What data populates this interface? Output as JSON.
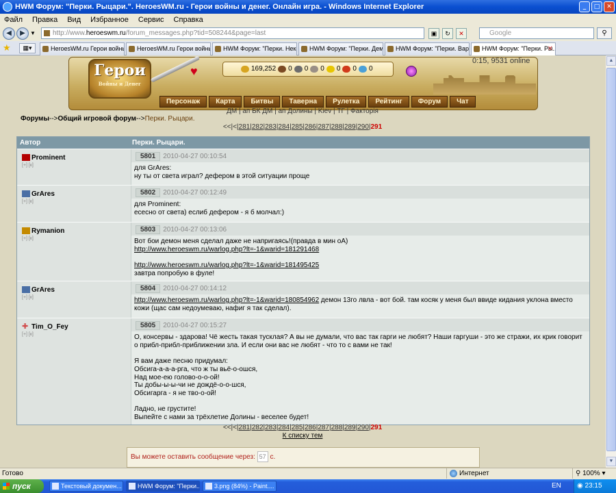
{
  "window": {
    "title": "HWM Форум: \"Перки. Рыцари.\". HeroesWM.ru - Герои войны и денег. Онлайн игра. - Windows Internet Explorer",
    "buttons": {
      "min": "_",
      "max": "□",
      "close": "✕"
    }
  },
  "menu": [
    "Файл",
    "Правка",
    "Вид",
    "Избранное",
    "Сервис",
    "Справка"
  ],
  "address": {
    "prefix": "http://www.",
    "host": "heroeswm.ru",
    "path": "/forum_messages.php?tid=508244&page=last"
  },
  "search": {
    "placeholder": "Google"
  },
  "tabs": [
    {
      "label": "HeroesWM.ru Герои войны ..."
    },
    {
      "label": "HeroesWM.ru Герои войны ..."
    },
    {
      "label": "HWM Форум: \"Перки. Некро..."
    },
    {
      "label": "HWM Форум: \"Перки. Демо..."
    },
    {
      "label": "HWM Форум: \"Перки. Варва..."
    },
    {
      "label": "HWM Форум: \"Перки. Ры..."
    }
  ],
  "game": {
    "logo_big": "Герои",
    "logo_small": "Войны и Денег",
    "resources": [
      "169,252",
      "0",
      "0",
      "0",
      "0",
      "0",
      "0"
    ],
    "resource_colors": [
      "#d7a521",
      "#7b4a23",
      "#6d6d6d",
      "#9a8f86",
      "#e8c600",
      "#d13a1b",
      "#4aa0d8"
    ],
    "online": "0:15, 9531 online",
    "nav": [
      "Персонаж",
      "Карта",
      "Битвы",
      "Таверна",
      "Рулетка",
      "Рейтинг",
      "Форум",
      "Чат"
    ],
    "sublinks": "ДМ | ап БК ДМ | ап Долины | Kiev | ТГ | Факторія"
  },
  "breadcrumb": {
    "forums": "Форумы",
    "sep1": "-->",
    "section": "Общий игровой форум",
    "sep2": "-->",
    "current": "Перки. Рыцари."
  },
  "pager": {
    "prefix": "<<|<|",
    "pages": [
      "281",
      "282",
      "283",
      "284",
      "285",
      "286",
      "287",
      "288",
      "289",
      "290"
    ],
    "current": "291"
  },
  "table": {
    "col_author": "Автор",
    "col_topic": "Перки. Рыцари."
  },
  "posts": [
    {
      "author": "Prominent",
      "icon_color": "#b30000",
      "small": "[+] [к]",
      "num": "5801",
      "date": "2010-04-27 00:10:54",
      "lines": [
        "для GrAres:",
        "ну ты от света играл? дефером в этой ситуации проще"
      ],
      "links": []
    },
    {
      "author": "GrAres",
      "icon_color": "#4a6fa5",
      "small": "[+] [к]",
      "num": "5802",
      "date": "2010-04-27 00:12:49",
      "lines": [
        "для Prominent:",
        "есесно от света) еслиб дефером - я б молчал:)"
      ],
      "links": []
    },
    {
      "author": "Rymanion",
      "icon_color": "#c48a00",
      "small": "[+] [к]",
      "num": "5803",
      "date": "2010-04-27 00:13:06",
      "lines": [
        "Вот бои демон меня сделал даже не напригаясь!(правда в мин оА)"
      ],
      "links": [
        "http://www.heroeswm.ru/warlog.php?lt=-1&warid=181291468",
        "http://www.heroeswm.ru/warlog.php?lt=-1&warid=181495425"
      ],
      "tail": "завтра попробую в фуле!"
    },
    {
      "author": "GrAres",
      "icon_color": "#4a6fa5",
      "small": "[+] [к]",
      "num": "5804",
      "date": "2010-04-27 00:14:12",
      "link_inline": "http://www.heroeswm.ru/warlog.php?lt=-1&warid=180854962",
      "after_link": " демон 13го лвла - вот бой. там косяк у меня был ввиде кидания уклона вместо кожи (щас сам недоумеваю, нафиг я так сделал)."
    },
    {
      "author": "Tim_O_Fey",
      "icon_color": "#d04a4a",
      "small": "[+] [к]",
      "num": "5805",
      "date": "2010-04-27 00:15:27",
      "text": "О, консервы - здарова! Чё жесть такая тусклая? А вы не думали, что вас так гарги не любят? Наши гаргуши - это же стражи, их крик говорит о прибл-прибл-приближении зла. И если они вас не любят - что то с вами не так!\n\nЯ вам даже песню придумал:\nОбсига-а-а-а-рга, что ж ты вьё-о-ошся,\nНад мое-ею голово-о-о-ой!\nТы добы-ы-ы-чи не дождё-о-о-шся,\nОбсигарга - я не тво-о-ой!\n\nЛадно, не грустите!\nВыпейте с нами за трёхлетие Долины - веселее будет!"
    }
  ],
  "back_to_list": "К списку тем",
  "reply": {
    "text": "Вы можете оставить сообщение через:",
    "count": "57",
    "unit": "с."
  },
  "status": {
    "text": "Готово",
    "zone": "Интернет",
    "zoom": "100%"
  },
  "taskbar": {
    "start": "пуск",
    "tasks": [
      "Текстовый докумен...",
      "HWM Форум: \"Перки...",
      "3.png (84%) - Paint...."
    ],
    "lang": "EN",
    "clock": "23:15"
  }
}
